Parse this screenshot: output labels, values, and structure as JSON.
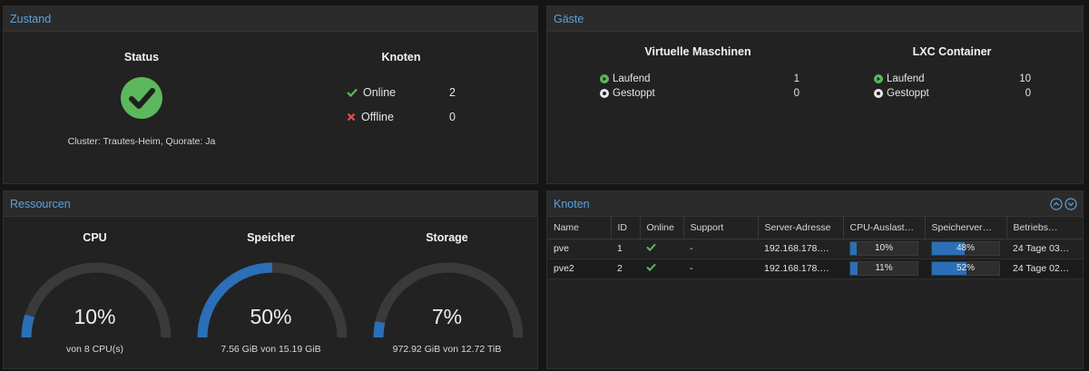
{
  "colors": {
    "accent": "#5aa1e0",
    "ok": "#5cb85c",
    "error": "#e04e4e",
    "bar": "#2a6fb8"
  },
  "zustand": {
    "title": "Zustand",
    "status_title": "Status",
    "status_icon": "check-circle-icon",
    "cluster_info": "Cluster: Trautes-Heim, Quorate: Ja",
    "knoten_title": "Knoten",
    "online_label": "Online",
    "online_count": "2",
    "offline_label": "Offline",
    "offline_count": "0"
  },
  "gaeste": {
    "title": "Gäste",
    "vm": {
      "title": "Virtuelle Maschinen",
      "running_label": "Laufend",
      "running": "1",
      "stopped_label": "Gestoppt",
      "stopped": "0"
    },
    "lxc": {
      "title": "LXC Container",
      "running_label": "Laufend",
      "running": "10",
      "stopped_label": "Gestoppt",
      "stopped": "0"
    }
  },
  "ressourcen": {
    "title": "Ressourcen",
    "gauges": [
      {
        "title": "CPU",
        "percent_label": "10%",
        "fraction": 0.1,
        "detail": "von 8 CPU(s)"
      },
      {
        "title": "Speicher",
        "percent_label": "50%",
        "fraction": 0.5,
        "detail": "7.56 GiB von 15.19 GiB"
      },
      {
        "title": "Storage",
        "percent_label": "7%",
        "fraction": 0.07,
        "detail": "972.92 GiB von 12.72 TiB"
      }
    ]
  },
  "knoten": {
    "title": "Knoten",
    "columns": [
      "Name",
      "ID",
      "Online",
      "Support",
      "Server-Adresse",
      "CPU-Auslast…",
      "Speicherver…",
      "Betriebs…"
    ],
    "rows": [
      {
        "name": "pve",
        "id": "1",
        "support": "-",
        "address": "192.168.178.…",
        "cpu_label": "10%",
        "cpu": 0.1,
        "mem_label": "48%",
        "mem": 0.48,
        "uptime": "24 Tage 03…"
      },
      {
        "name": "pve2",
        "id": "2",
        "support": "-",
        "address": "192.168.178.…",
        "cpu_label": "11%",
        "cpu": 0.11,
        "mem_label": "52%",
        "mem": 0.52,
        "uptime": "24 Tage 02…"
      }
    ]
  }
}
